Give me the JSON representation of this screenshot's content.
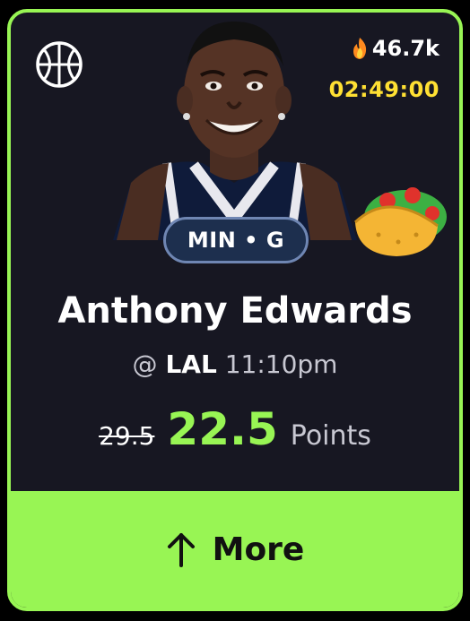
{
  "header": {
    "sport_icon": "basketball-icon",
    "hot_icon": "flame-icon",
    "hot_count": "46.7k",
    "timer": "02:49:00"
  },
  "player": {
    "team_position": "MIN • G",
    "name": "Anthony Edwards",
    "matchup_prefix": "@",
    "opponent": "LAL",
    "game_time": "11:10pm",
    "taco_icon": "taco-icon"
  },
  "projection": {
    "original_line": "29.5",
    "discounted_line": "22.5",
    "stat": "Points"
  },
  "actions": {
    "more_label": "More",
    "more_icon": "arrow-up-icon"
  },
  "colors": {
    "accent": "#98f554",
    "timer": "#ffe033",
    "card_bg": "#171722",
    "pill_bg": "#1d2f4e"
  }
}
